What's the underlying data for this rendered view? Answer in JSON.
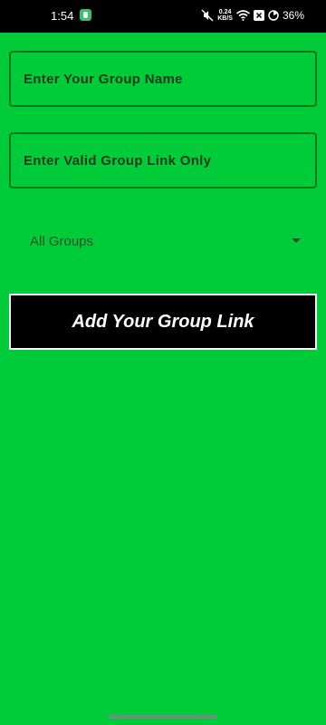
{
  "status_bar": {
    "time": "1:54",
    "speed_value": "0.24",
    "speed_unit": "KB/S",
    "battery": "36%"
  },
  "form": {
    "group_name_placeholder": "Enter Your Group Name",
    "group_link_placeholder": "Enter Valid Group Link Only",
    "category_select": {
      "selected": "All Groups"
    },
    "submit_label": "Add Your Group Link"
  },
  "icons": {
    "status": [
      "app-notification-icon",
      "mute-icon",
      "wifi-icon",
      "close-box-icon",
      "battery-icon"
    ],
    "dropdown": "caret-down-icon"
  },
  "colors": {
    "background": "#00cc3a",
    "field_border": "#03771c",
    "button_background": "#000000",
    "button_text": "#ffffff"
  }
}
